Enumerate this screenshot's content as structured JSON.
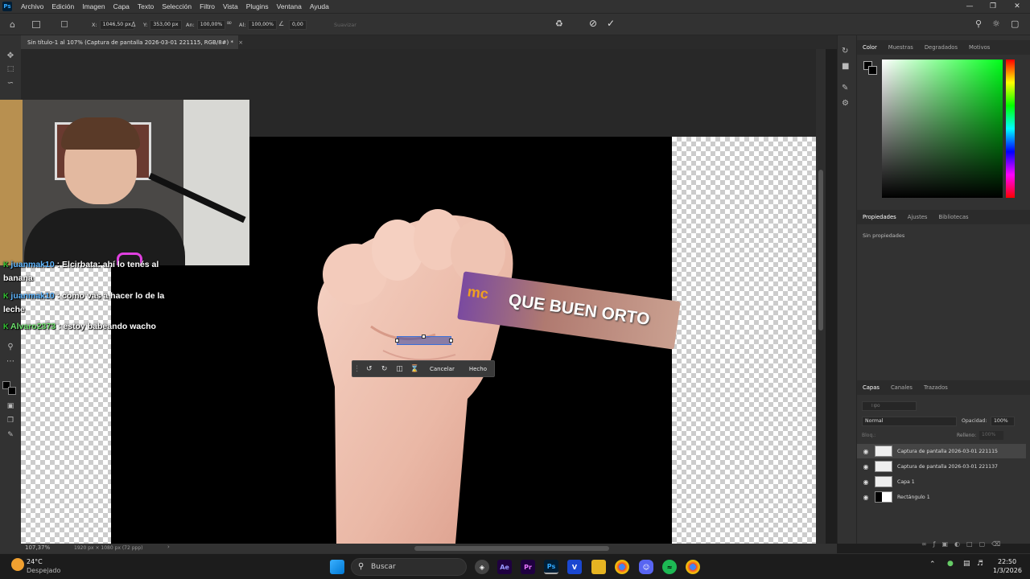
{
  "app": {
    "menu": [
      "Archivo",
      "Edición",
      "Imagen",
      "Capa",
      "Texto",
      "Selección",
      "Filtro",
      "Vista",
      "Plugins",
      "Ventana",
      "Ayuda"
    ],
    "logo": "Ps"
  },
  "options": {
    "x_label": "X:",
    "x_value": "1046,50 px",
    "y_label": "Y:",
    "y_value": "353,00 px",
    "w_label": "An:",
    "w_value": "100,00%",
    "h_label": "Al:",
    "h_value": "100,00%",
    "angle_value": "0,00",
    "smooth_label": "Suavizar"
  },
  "document": {
    "tab_title": "Sin título-1 al 107% (Captura de pantalla 2026-03-01 221115, RGB/8#) *",
    "tab_close": "×"
  },
  "canvas": {
    "sticker_brand": "mc",
    "sticker_text": "QUE BUEN ORTO",
    "transform_cancel": "Cancelar",
    "transform_done": "Hecho"
  },
  "chat": [
    {
      "user": "juanmak10",
      "text": ": Elcirbata: ahí lo tenés al",
      "cont": "banana"
    },
    {
      "user": "juanmak10",
      "text": ": como vas a hacer lo de la",
      "cont": "leche"
    },
    {
      "user": "Alvaro2373",
      "text": ": estoy babeando wacho",
      "cont": ""
    }
  ],
  "panels": {
    "color_tabs": [
      "Color",
      "Muestras",
      "Degradados",
      "Motivos"
    ],
    "props_tabs": [
      "Propiedades",
      "Ajustes",
      "Bibliotecas"
    ],
    "props_empty": "Sin propiedades",
    "layers_tabs": [
      "Capas",
      "Canales",
      "Trazados"
    ],
    "layer_search_placeholder": "Tipo",
    "blend_mode": "Normal",
    "opacity_label": "Opacidad:",
    "opacity_value": "100%",
    "lock_label": "Bloq.:",
    "fill_label": "Relleno:",
    "fill_value": "100%",
    "layers": [
      {
        "name": "Captura de pantalla 2026-03-01 221115",
        "selected": true
      },
      {
        "name": "Captura de pantalla 2026-03-01 221137",
        "selected": false
      },
      {
        "name": "Capa 1",
        "selected": false
      },
      {
        "name": "Rectángulo 1",
        "selected": false
      }
    ]
  },
  "status": {
    "zoom": "107,37%",
    "doc_info": "1920 px × 1080 px (72 ppp)"
  },
  "taskbar": {
    "weather_temp": "24°C",
    "weather_desc": "Despejado",
    "search_label": "Buscar",
    "time": "22:50",
    "date": "1/3/2026"
  },
  "colors": {
    "accent": "#31a8ff",
    "canvas_bg": "#282828",
    "panel_bg": "#323232"
  }
}
